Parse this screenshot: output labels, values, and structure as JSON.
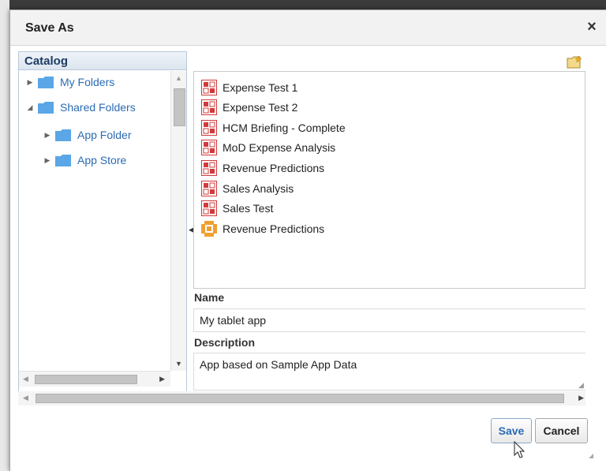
{
  "dialog": {
    "title": "Save As",
    "close_icon": "close-icon",
    "close_glyph": "×"
  },
  "catalog": {
    "header": "Catalog",
    "items": [
      {
        "label": "My Folders",
        "expanded": false,
        "level": 0
      },
      {
        "label": "Shared Folders",
        "expanded": true,
        "level": 0
      },
      {
        "label": "App Folder",
        "expanded": false,
        "level": 1
      },
      {
        "label": "App Store",
        "expanded": false,
        "level": 1
      }
    ]
  },
  "files": [
    {
      "label": "Expense Test 1",
      "icon": "analysis-report-icon"
    },
    {
      "label": "Expense Test 2",
      "icon": "analysis-report-icon"
    },
    {
      "label": "HCM Briefing - Complete",
      "icon": "analysis-report-icon"
    },
    {
      "label": "MoD Expense Analysis",
      "icon": "analysis-report-icon"
    },
    {
      "label": "Revenue Predictions",
      "icon": "analysis-report-icon"
    },
    {
      "label": "Sales Analysis",
      "icon": "analysis-report-icon"
    },
    {
      "label": "Sales Test",
      "icon": "analysis-report-icon"
    },
    {
      "label": "Revenue Predictions",
      "icon": "mobile-app-icon"
    }
  ],
  "form": {
    "name_label": "Name",
    "name_value": "My tablet app",
    "description_label": "Description",
    "description_value": "App based on Sample App Data"
  },
  "buttons": {
    "save": "Save",
    "cancel": "Cancel"
  },
  "colors": {
    "link_blue": "#2a6bb3",
    "catalog_header_text": "#1f3b63",
    "report_icon_red": "#d23a3a",
    "app_icon_orange": "#f0a030",
    "folder_blue": "#5aa6e6"
  }
}
